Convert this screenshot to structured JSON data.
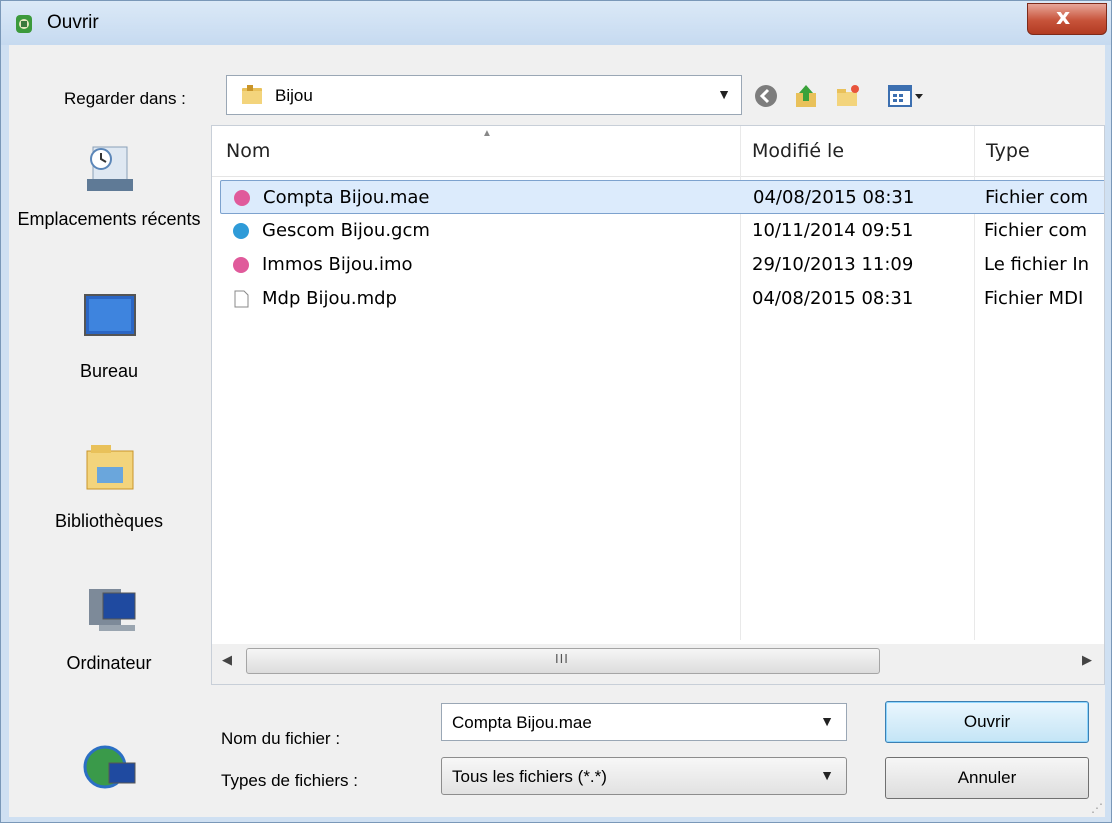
{
  "window": {
    "title": "Ouvrir",
    "close_label": "x"
  },
  "toolbar": {
    "lookin_label": "Regarder dans :",
    "lookin_value": "Bijou"
  },
  "places": [
    {
      "label": "Emplacements récents",
      "icon": "recent-places-icon"
    },
    {
      "label": "Bureau",
      "icon": "desktop-icon"
    },
    {
      "label": "Bibliothèques",
      "icon": "libraries-icon"
    },
    {
      "label": "Ordinateur",
      "icon": "computer-icon"
    },
    {
      "label": "",
      "icon": "network-icon"
    }
  ],
  "filelist": {
    "columns": {
      "name": "Nom",
      "modified": "Modifié le",
      "type": "Type"
    },
    "scroll_grip": "III",
    "rows": [
      {
        "name": "Compta Bijou.mae",
        "modified": "04/08/2015 08:31",
        "type": "Fichier com",
        "icon_color": "#e05a9b",
        "selected": true
      },
      {
        "name": "Gescom Bijou.gcm",
        "modified": "10/11/2014 09:51",
        "type": "Fichier com",
        "icon_color": "#2f9bd8",
        "selected": false
      },
      {
        "name": "Immos Bijou.imo",
        "modified": "29/10/2013 11:09",
        "type": "Le fichier In",
        "icon_color": "#e05a9b",
        "selected": false
      },
      {
        "name": "Mdp Bijou.mdp",
        "modified": "04/08/2015 08:31",
        "type": "Fichier MDI",
        "icon_color": "#ffffff",
        "selected": false
      }
    ]
  },
  "form": {
    "filename_label": "Nom du fichier :",
    "filename_value": "Compta Bijou.mae",
    "filetype_label": "Types de fichiers :",
    "filetype_value": "Tous les fichiers (*.*)",
    "open_label": "Ouvrir",
    "cancel_label": "Annuler"
  }
}
